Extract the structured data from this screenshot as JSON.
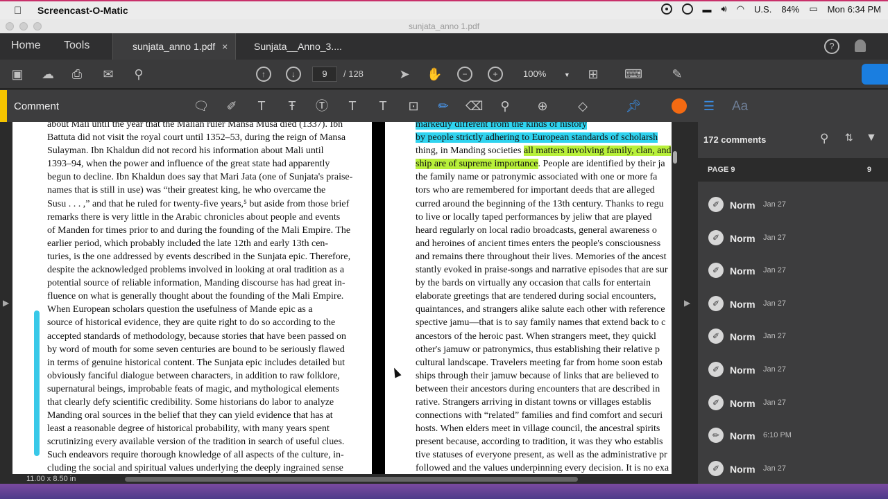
{
  "menubar": {
    "app_name": "Screencast-O-Matic",
    "input_source": "U.S.",
    "battery": "84%",
    "clock": "Mon 6:34 PM"
  },
  "window": {
    "title": "sunjata_anno 1.pdf"
  },
  "nav": {
    "home": "Home",
    "tools": "Tools"
  },
  "tabs": [
    {
      "label": "sunjata_anno 1.pdf",
      "close": "×"
    },
    {
      "label": "Sunjata__Anno_3...."
    }
  ],
  "help_label": "?",
  "toolbar": {
    "page_current": "9",
    "page_total": "/ 128",
    "zoom": "100%"
  },
  "comment_toolbar": {
    "label": "Comment",
    "highlight_color": "#f46a12",
    "text_size_label": "Aa"
  },
  "document": {
    "left_lines": [
      "about Mali until the year that the Malian ruler Mansa Musa died (1337). Ibn",
      "Battuta did not visit the royal court until 1352–53, during the reign of Mansa",
      "Sulayman. Ibn Khaldun did not record his information about Mali until",
      "1393–94, when the power and influence of the great state had apparently",
      "begun to decline. Ibn Khaldun does say that Mari Jata (one of Sunjata's praise-",
      "names that is still in use) was “their greatest king, he who overcame the",
      "Susu . . . ,” and that he ruled for twenty-five years,⁵ but aside from those brief",
      "remarks there is very little in the Arabic chronicles about people and events",
      "of Manden for times prior to and during the founding of the Mali Empire. The",
      "earlier period, which probably included the late 12th and early 13th cen-",
      "turies, is the one addressed by events described in the Sunjata epic. Therefore,",
      "despite the acknowledged problems involved in looking at oral tradition as a",
      "potential source of reliable information, Manding discourse has had great in-",
      "fluence on what is generally thought about the founding of the Mali Empire.",
      "    When European scholars question the usefulness of Mande epic as a",
      "source of historical evidence, they are quite right to do so according to the",
      "accepted standards of methodology, because stories that have been passed on",
      "by word of mouth for some seven centuries are bound to be seriously flawed",
      "in terms of genuine historical content. The Sunjata epic includes detailed but",
      "obviously fanciful dialogue between characters, in addition to raw folklore,",
      "supernatural beings, improbable feats of magic, and mythological elements",
      "that clearly defy scientific credibility. Some historians do labor to analyze",
      "Manding oral sources in the belief that they can yield evidence that has at",
      "least a reasonable degree of historical probability, with many years spent",
      "scrutinizing every available version of the tradition in search of useful clues.",
      "Such endeavors require thorough knowledge of all aspects of the culture, in-",
      "cluding the social and spiritual values underlying the deeply ingrained sense"
    ],
    "right": {
      "line0": "markedly different from the kinds of history",
      "line1": "by people strictly adhering to European standards of scholarsh",
      "line2_pre": "thing, in Manding societies ",
      "line2_hl": "all matters involving family, clan, and",
      "line3_hl": "ship are of supreme importance",
      "line3_post": ". People are identified by their ja",
      "lines": [
        "the family name or patronymic associated with one or more fa",
        "tors who are remembered for important deeds that are alleged",
        "curred around the beginning of the 13th century. Thanks to regu",
        "to live or locally taped performances by jeliw that are played",
        "heard regularly on local radio broadcasts, general awareness o",
        "and heroines of ancient times enters the people's consciousness",
        "and remains there throughout their lives. Memories of the ancest",
        "stantly evoked in praise-songs and narrative episodes that are sur",
        "by the bards on virtually any occasion that calls for entertain",
        "elaborate greetings that are tendered during social encounters,",
        "quaintances, and strangers alike salute each other with reference",
        "spective jamu—that is to say family names that extend back to c",
        "ancestors of the heroic past. When strangers meet, they quickl",
        "other's jamuw or patronymics, thus establishing their relative p",
        "cultural landscape. Travelers meeting far from home soon estab",
        "ships through their jamuw because of links that are believed to",
        "between their ancestors during encounters that are described in",
        "rative. Strangers arriving in distant towns or villages establis",
        "connections with “related” families and find comfort and securi",
        "hosts. When elders meet in village council, the ancestral spirits",
        "present because, according to tradition, it was they who establis",
        "tive statuses of everyone present, as well as the administrative pr",
        "followed and the values underpinning every decision. It is no exa"
      ]
    },
    "page_size": "11.00 x 8.50 in",
    "highlight_colors": {
      "cyan": "#2fd3ef",
      "green": "#b8f03a"
    }
  },
  "comments_panel": {
    "count": "172 comments",
    "page_label": "PAGE 9",
    "page_count": "9",
    "items": [
      {
        "author": "Norm",
        "date": "Jan 27",
        "icon": "highlight-icon"
      },
      {
        "author": "Norm",
        "date": "Jan 27",
        "icon": "highlight-icon"
      },
      {
        "author": "Norm",
        "date": "Jan 27",
        "icon": "highlight-icon"
      },
      {
        "author": "Norm",
        "date": "Jan 27",
        "icon": "highlight-icon"
      },
      {
        "author": "Norm",
        "date": "Jan 27",
        "icon": "highlight-icon"
      },
      {
        "author": "Norm",
        "date": "Jan 27",
        "icon": "highlight-icon"
      },
      {
        "author": "Norm",
        "date": "Jan 27",
        "icon": "highlight-icon"
      },
      {
        "author": "Norm",
        "date": "6:10 PM",
        "icon": "pencil-icon"
      },
      {
        "author": "Norm",
        "date": "Jan 27",
        "icon": "highlight-icon"
      }
    ]
  }
}
